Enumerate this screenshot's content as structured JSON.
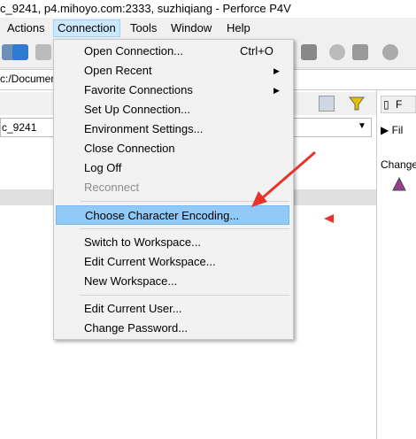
{
  "window": {
    "title": "c_9241,  p4.mihoyo.com:2333,  suzhiqiang - Perforce P4V"
  },
  "menubar": {
    "items": [
      {
        "name": "menu-actions",
        "label": "Actions"
      },
      {
        "name": "menu-connection",
        "label": "Connection"
      },
      {
        "name": "menu-tools",
        "label": "Tools"
      },
      {
        "name": "menu-window",
        "label": "Window"
      },
      {
        "name": "menu-help",
        "label": "Help"
      }
    ]
  },
  "path": {
    "text": "c:/Document/"
  },
  "workspace": {
    "combo_value": "c_9241"
  },
  "right_pane": {
    "tab_label": "F",
    "play_label": "Fil",
    "change_label": "Change"
  },
  "connection_menu": {
    "items": [
      {
        "label": "Open Connection...",
        "shortcut": "Ctrl+O",
        "submenu": false,
        "enabled": true
      },
      {
        "label": "Open Recent",
        "shortcut": "",
        "submenu": true,
        "enabled": true
      },
      {
        "label": "Favorite Connections",
        "shortcut": "",
        "submenu": true,
        "enabled": true
      },
      {
        "label": "Set Up Connection...",
        "shortcut": "",
        "submenu": false,
        "enabled": true
      },
      {
        "label": "Environment Settings...",
        "shortcut": "",
        "submenu": false,
        "enabled": true
      },
      {
        "label": "Close Connection",
        "shortcut": "",
        "submenu": false,
        "enabled": true
      },
      {
        "label": "Log Off",
        "shortcut": "",
        "submenu": false,
        "enabled": true
      },
      {
        "label": "Reconnect",
        "shortcut": "",
        "submenu": false,
        "enabled": false
      },
      {
        "label": "Choose Character Encoding...",
        "shortcut": "",
        "submenu": false,
        "enabled": true,
        "highlighted": true
      },
      {
        "label": "Switch to Workspace...",
        "shortcut": "",
        "submenu": false,
        "enabled": true
      },
      {
        "label": "Edit Current Workspace...",
        "shortcut": "",
        "submenu": false,
        "enabled": true
      },
      {
        "label": "New Workspace...",
        "shortcut": "",
        "submenu": false,
        "enabled": true
      },
      {
        "label": "Edit Current User...",
        "shortcut": "",
        "submenu": false,
        "enabled": true
      },
      {
        "label": "Change Password...",
        "shortcut": "",
        "submenu": false,
        "enabled": true
      }
    ]
  },
  "colors": {
    "highlight": "#91c9f7",
    "annotation_arrow": "#e8332a"
  }
}
